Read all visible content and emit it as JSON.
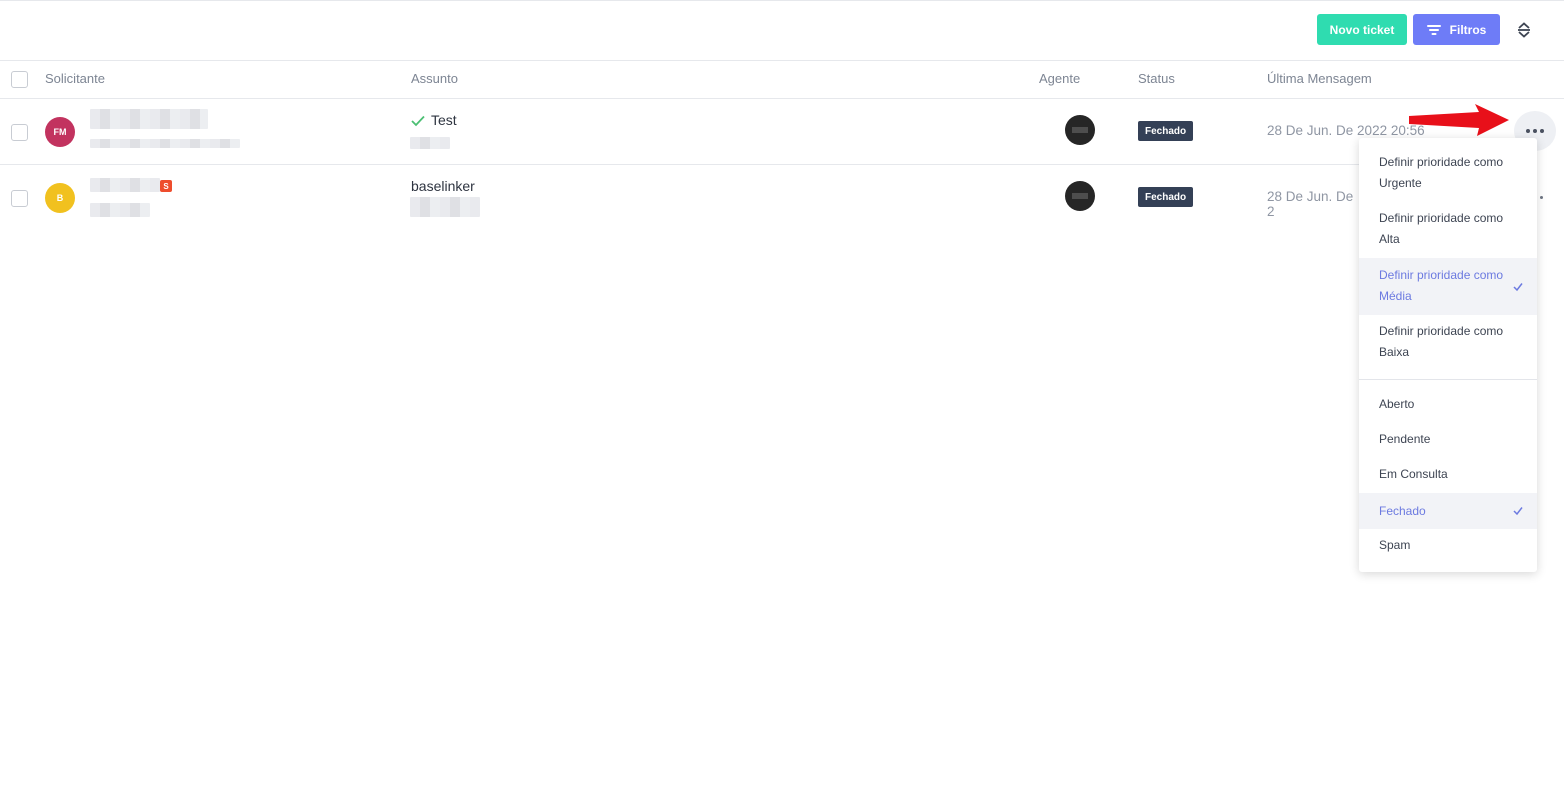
{
  "toolbar": {
    "new_ticket_label": "Novo ticket",
    "filters_label": "Filtros",
    "new_ticket_color": "#2fdcb0",
    "filters_color": "#6e7cf7",
    "sort_icon": "sort-up-down-icon"
  },
  "table": {
    "columns": {
      "requester": "Solicitante",
      "subject": "Assunto",
      "agent": "Agente",
      "status": "Status",
      "last_message": "Última Mensagem"
    },
    "rows": [
      {
        "avatar_initials": "FM",
        "avatar_color": "#c2335f",
        "subject": "Test",
        "subject_icon": "check-icon",
        "status": "Fechado",
        "last_message": "28 De Jun. De 2022 20:56"
      },
      {
        "avatar_initials": "B",
        "avatar_color": "#f1c11f",
        "subject": "baselinker",
        "status": "Fechado",
        "last_message": "28 De Jun. De 2"
      }
    ]
  },
  "menu": {
    "priority_items": [
      {
        "label": "Definir prioridade como Urgente",
        "selected": false
      },
      {
        "label": "Definir prioridade como Alta",
        "selected": false
      },
      {
        "label": "Definir prioridade como Média",
        "selected": true
      },
      {
        "label": "Definir prioridade como Baixa",
        "selected": false
      }
    ],
    "status_items": [
      {
        "label": "Aberto",
        "selected": false
      },
      {
        "label": "Pendente",
        "selected": false
      },
      {
        "label": "Em Consulta",
        "selected": false
      },
      {
        "label": "Fechado",
        "selected": true
      },
      {
        "label": "Spam",
        "selected": false
      }
    ],
    "selected_color": "#6c7ae0"
  }
}
